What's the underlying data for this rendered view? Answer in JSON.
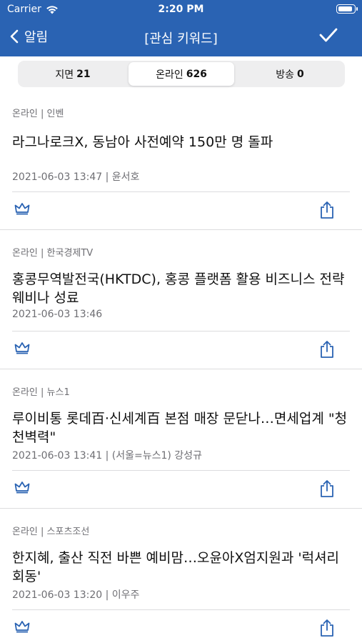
{
  "status_bar": {
    "carrier": "Carrier",
    "time": "2:20 PM"
  },
  "nav": {
    "back_label": "알림",
    "title": "[관심 키워드]"
  },
  "segments": [
    {
      "label": "지면",
      "count": "21",
      "active": false
    },
    {
      "label": "온라인",
      "count": "626",
      "active": true
    },
    {
      "label": "방송",
      "count": "0",
      "active": false
    }
  ],
  "articles": [
    {
      "category": "온라인 | 인벤",
      "title": "라그나로크X, 동남아 사전예약 150만 명 돌파",
      "meta": "2021-06-03 13:47 | 윤서호"
    },
    {
      "category": "온라인 | 한국경제TV",
      "title": "홍콩무역발전국(HKTDC), 홍콩 플랫폼 활용 비즈니스 전략 웨비나 성료",
      "meta": "2021-06-03 13:46"
    },
    {
      "category": "온라인 | 뉴스1",
      "title": "루이비통 롯데百·신세계百 본점 매장 문닫나…면세업계 \"청천벽력\"",
      "meta": "2021-06-03 13:41 | (서울=뉴스1) 강성규"
    },
    {
      "category": "온라인 | 스포츠조선",
      "title": "한지혜, 출산 직전 바쁜 예비맘…오윤아X엄지원과 '럭셔리 회동'",
      "meta": "2021-06-03 13:20 | 이우주"
    }
  ],
  "colors": {
    "header": "#2a63b3",
    "accent": "#2a63b3"
  }
}
